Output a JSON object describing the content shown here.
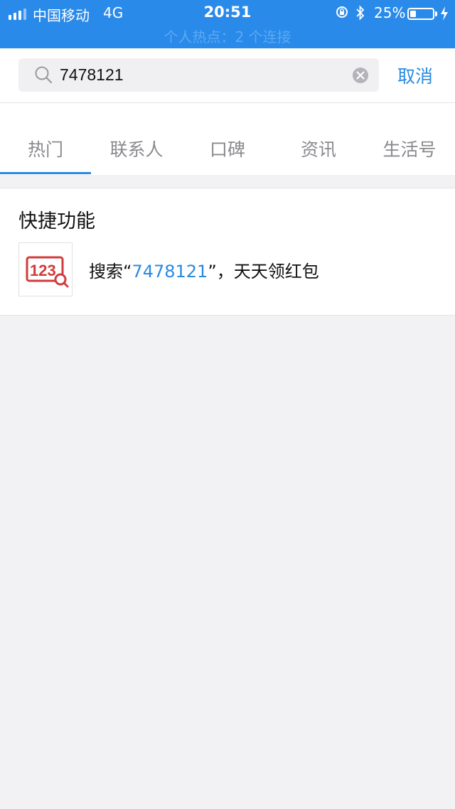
{
  "status_bar": {
    "carrier": "中国移动",
    "network": "4G",
    "time": "20:51",
    "battery_percent": "25%",
    "battery_level": 0.25,
    "hotspot": "个人热点：2 个连接"
  },
  "search": {
    "value": "7478121",
    "cancel_label": "取消"
  },
  "tabs": [
    {
      "label": "热门",
      "active": true
    },
    {
      "label": "联系人",
      "active": false
    },
    {
      "label": "口碑",
      "active": false
    },
    {
      "label": "资讯",
      "active": false
    },
    {
      "label": "生活号",
      "active": false
    }
  ],
  "quick": {
    "title": "快捷功能",
    "item": {
      "icon_text": "123",
      "prefix": "搜索“",
      "query": "7478121",
      "suffix": "”，天天领红包"
    }
  },
  "colors": {
    "accent": "#2a8ae0",
    "status_bar": "#2a8aea",
    "icon_red": "#d23b3b"
  }
}
